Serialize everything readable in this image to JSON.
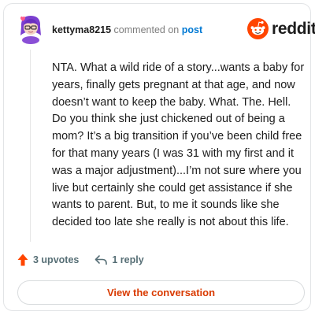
{
  "comment": {
    "username": "kettyma8215",
    "action_text": "commented on",
    "post_link_label": "post",
    "body": "NTA. What a wild ride of a story...wants a baby for years, finally gets pregnant at that age, and now doesn’t want to keep the baby. What. The. Hell. Do you think she just chickened out of being a mom? It’s a big transition if you’ve been child free for that many years (I was 31 with my first and it was a major adjustment)...I’m not sure where you live but certainly she could get assistance if she wants to parent. But, to me it sounds like she decided too late she really is not about this life."
  },
  "brand": {
    "wordmark": "reddit",
    "color": "#ff4500"
  },
  "actions": {
    "upvotes_label": "3 upvotes",
    "replies_label": "1 reply"
  },
  "footer": {
    "view_conversation_label": "View the conversation"
  },
  "icons": {
    "avatar": "user-avatar",
    "logo": "reddit-snoo-icon",
    "upvote": "upvote-arrow-icon",
    "reply": "reply-arrow-icon"
  },
  "colors": {
    "username": "#1c1c1c",
    "muted": "#7c7c7c",
    "link": "#0079d3",
    "upvote": "#ff4500",
    "button_text": "#d93a00"
  }
}
